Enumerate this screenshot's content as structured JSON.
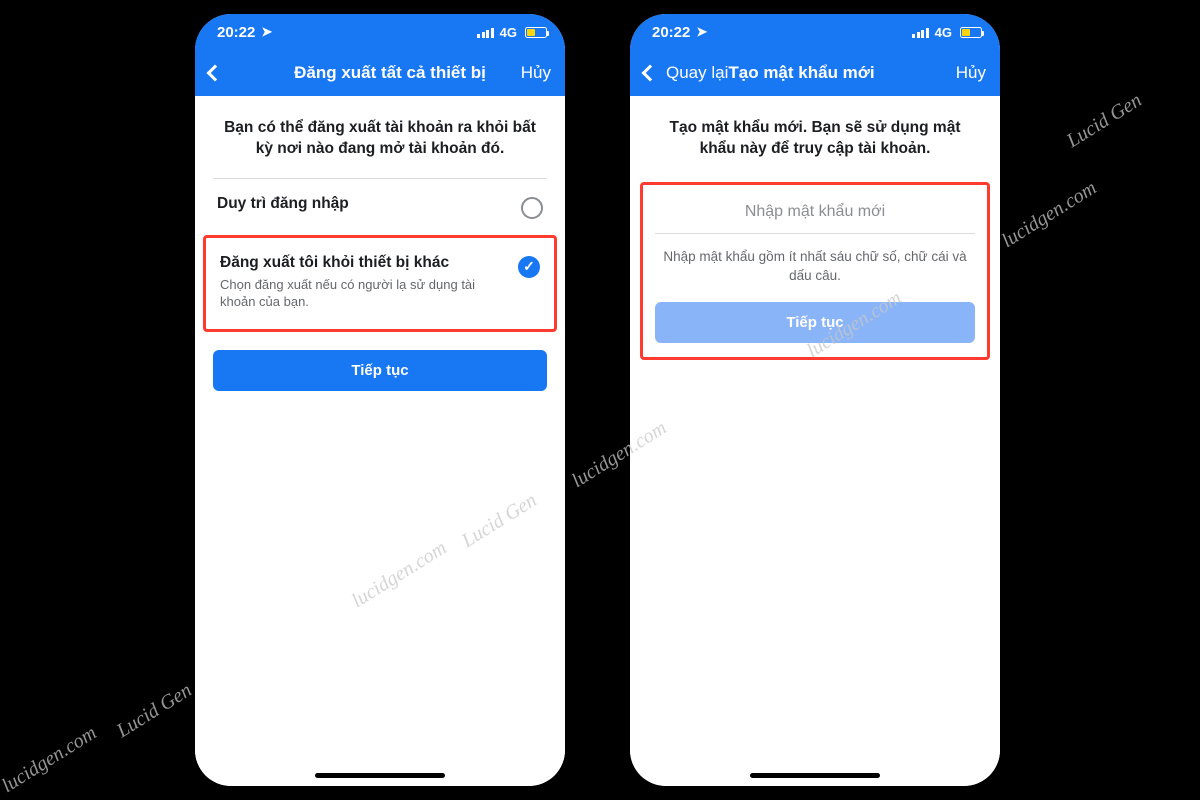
{
  "status": {
    "time": "20:22",
    "network": "4G"
  },
  "watermark": {
    "brand": "Lucid Gen",
    "domain": "lucidgen.com"
  },
  "leftPhone": {
    "nav": {
      "title": "Đăng xuất tất cả thiết bị",
      "cancel": "Hủy"
    },
    "prompt": "Bạn có thể đăng xuất tài khoản ra khỏi bất kỳ nơi nào đang mở tài khoản đó.",
    "option1": {
      "title": "Duy trì đăng nhập"
    },
    "option2": {
      "title": "Đăng xuất tôi khỏi thiết bị khác",
      "sub": "Chọn đăng xuất nếu có người lạ sử dụng tài khoản của bạn."
    },
    "continue": "Tiếp tục"
  },
  "rightPhone": {
    "nav": {
      "back": "Quay lại",
      "title": "Tạo mật khẩu mới",
      "cancel": "Hủy"
    },
    "prompt": "Tạo mật khẩu mới. Bạn sẽ sử dụng mật khẩu này để truy cập tài khoản.",
    "placeholder": "Nhập mật khẩu mới",
    "help": "Nhập mật khẩu gồm ít nhất sáu chữ số, chữ cái và dấu câu.",
    "continue": "Tiếp tục"
  }
}
